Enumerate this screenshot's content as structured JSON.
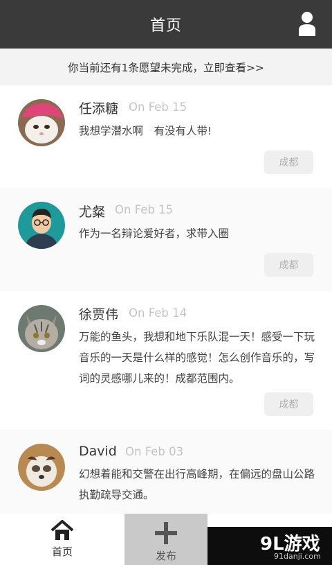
{
  "header": {
    "title": "首页",
    "user_icon": "user-icon"
  },
  "notice": {
    "text": "你当前还有1条愿望未完成，立即查看>>"
  },
  "posts": [
    {
      "name": "任添糖",
      "date": "On Feb 15",
      "content": "我想学潜水啊　有没有人带!",
      "city": "成都",
      "avatar": "pink-hat-cat-avatar"
    },
    {
      "name": "尤粲",
      "date": "On Feb 15",
      "content": "作为一名辩论爱好者，求带入圈",
      "city": "成都",
      "avatar": "cartoon-man-avatar"
    },
    {
      "name": "徐贾伟",
      "date": "On Feb 14",
      "content": "万能的鱼头，我想和地下乐队混一天！感受一下玩音乐的一天是什么样的感觉！怎么创作音乐的，写词的灵感哪儿来的！成都范围内。",
      "city": "成都",
      "avatar": "tabby-cat-avatar"
    },
    {
      "name": "David",
      "date": "On Feb 03",
      "content": "幻想着能和交警在出行高峰期，在偏远的盘山公路执勤疏导交通。",
      "city": "",
      "avatar": "dog-avatar"
    }
  ],
  "tabbar": {
    "home_label": "首页",
    "publish_label": "发布"
  },
  "watermark": {
    "main": "9L游戏",
    "sub": "91danji.com"
  },
  "colors": {
    "header_bg": "#3a3a3a",
    "card_alt_bg": "#fafafa",
    "city_badge_bg": "#efefef",
    "publish_tab_bg": "#c9c9c9"
  }
}
